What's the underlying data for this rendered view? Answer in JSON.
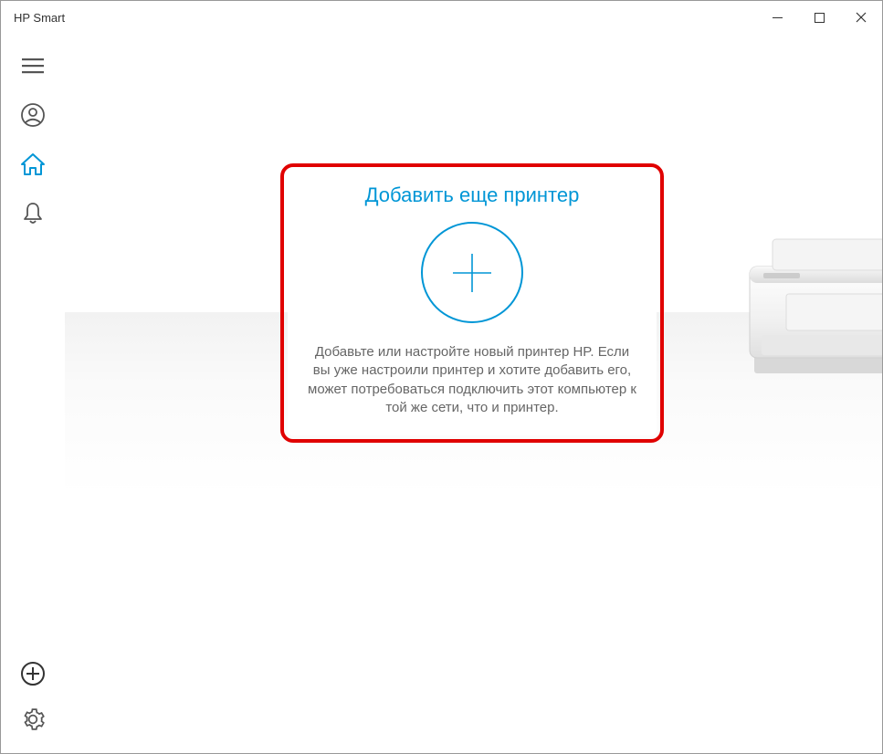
{
  "window": {
    "title": "HP Smart"
  },
  "sidebar": {
    "menu": "menu",
    "account": "account",
    "home": "home",
    "notifications": "notifications",
    "add": "add",
    "settings": "settings"
  },
  "card": {
    "title": "Добавить еще принтер",
    "description": "Добавьте или настройте новый принтер HP. Если вы уже настроили принтер и хотите добавить его, может потребоваться подключить этот компьютер к той же сети, что и принтер."
  },
  "colors": {
    "accent": "#0096d6",
    "highlight": "#e00000"
  }
}
